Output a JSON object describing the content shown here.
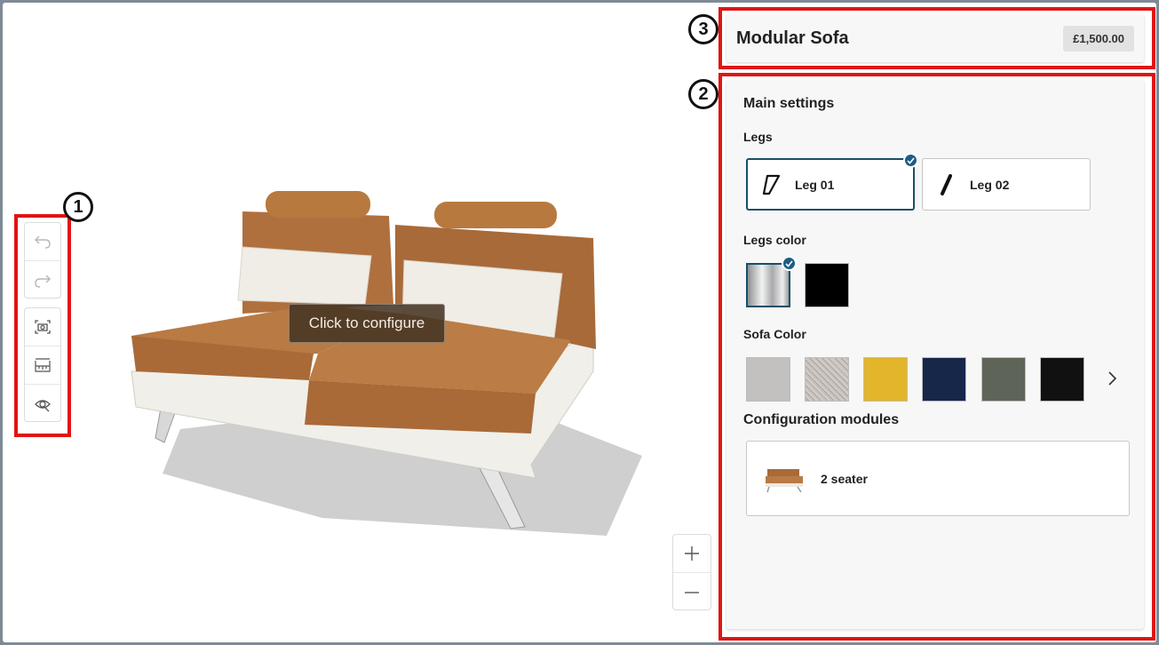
{
  "product": {
    "title": "Modular Sofa",
    "price": "£1,500.00"
  },
  "viewer": {
    "tooltip": "Click to configure"
  },
  "callouts": {
    "toolbar": "1",
    "settings": "2",
    "header": "3"
  },
  "toolbar": {
    "items": [
      {
        "icon": "undo-icon"
      },
      {
        "icon": "redo-icon"
      },
      {
        "icon": "screenshot-icon"
      },
      {
        "icon": "dimensions-icon"
      },
      {
        "icon": "view-ar-icon"
      }
    ]
  },
  "zoom": {
    "in_symbol": "+",
    "out_symbol": "−"
  },
  "panel": {
    "section_title": "Main settings",
    "legs": {
      "label": "Legs",
      "options": [
        {
          "label": "Leg 01",
          "selected": true
        },
        {
          "label": "Leg 02",
          "selected": false
        }
      ]
    },
    "legs_color": {
      "label": "Legs color",
      "options": [
        {
          "name": "chrome",
          "color": "#c9cbcd",
          "selected": true
        },
        {
          "name": "black",
          "color": "#000000",
          "selected": false
        }
      ]
    },
    "sofa_color": {
      "label": "Sofa Color",
      "options": [
        {
          "name": "light-grey",
          "color": "#c3c1bf"
        },
        {
          "name": "speckled-grey",
          "color": "#bdb8b4"
        },
        {
          "name": "mustard",
          "color": "#e3b52a"
        },
        {
          "name": "navy",
          "color": "#16274a"
        },
        {
          "name": "olive-grey",
          "color": "#5e6558"
        },
        {
          "name": "black",
          "color": "#111111"
        }
      ]
    },
    "modules": {
      "label": "Configuration modules",
      "items": [
        {
          "label": "2 seater"
        }
      ]
    }
  },
  "colors": {
    "accent": "#1a4f66",
    "callout": "#e01414",
    "upholstery": "#b0703e"
  }
}
